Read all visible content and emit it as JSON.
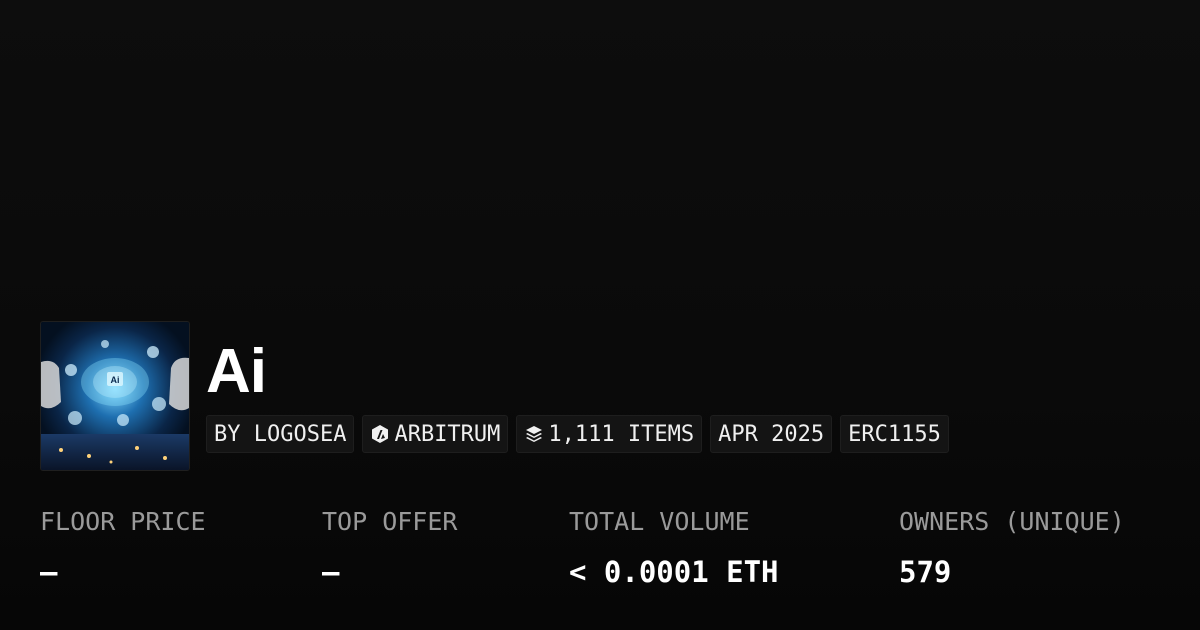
{
  "collection": {
    "title": "Ai",
    "image_icon": "ai-brain-artwork"
  },
  "chips": {
    "creator": "BY LOGOSEA",
    "chain": "ARBITRUM",
    "chain_icon": "arbitrum-logo-icon",
    "items": "1,111 ITEMS",
    "items_icon": "layers-icon",
    "date": "APR 2025",
    "standard": "ERC1155"
  },
  "stats": {
    "floor_price": {
      "label": "FLOOR PRICE",
      "value": "—"
    },
    "top_offer": {
      "label": "TOP OFFER",
      "value": "—"
    },
    "total_volume": {
      "label": "TOTAL VOLUME",
      "value": "< 0.0001 ETH"
    },
    "owners": {
      "label": "OWNERS (UNIQUE)",
      "value": "579"
    }
  },
  "colors": {
    "background": "#0b0b0b",
    "chip_background": "#141414",
    "label": "#9a9a9a",
    "value": "#ffffff"
  }
}
